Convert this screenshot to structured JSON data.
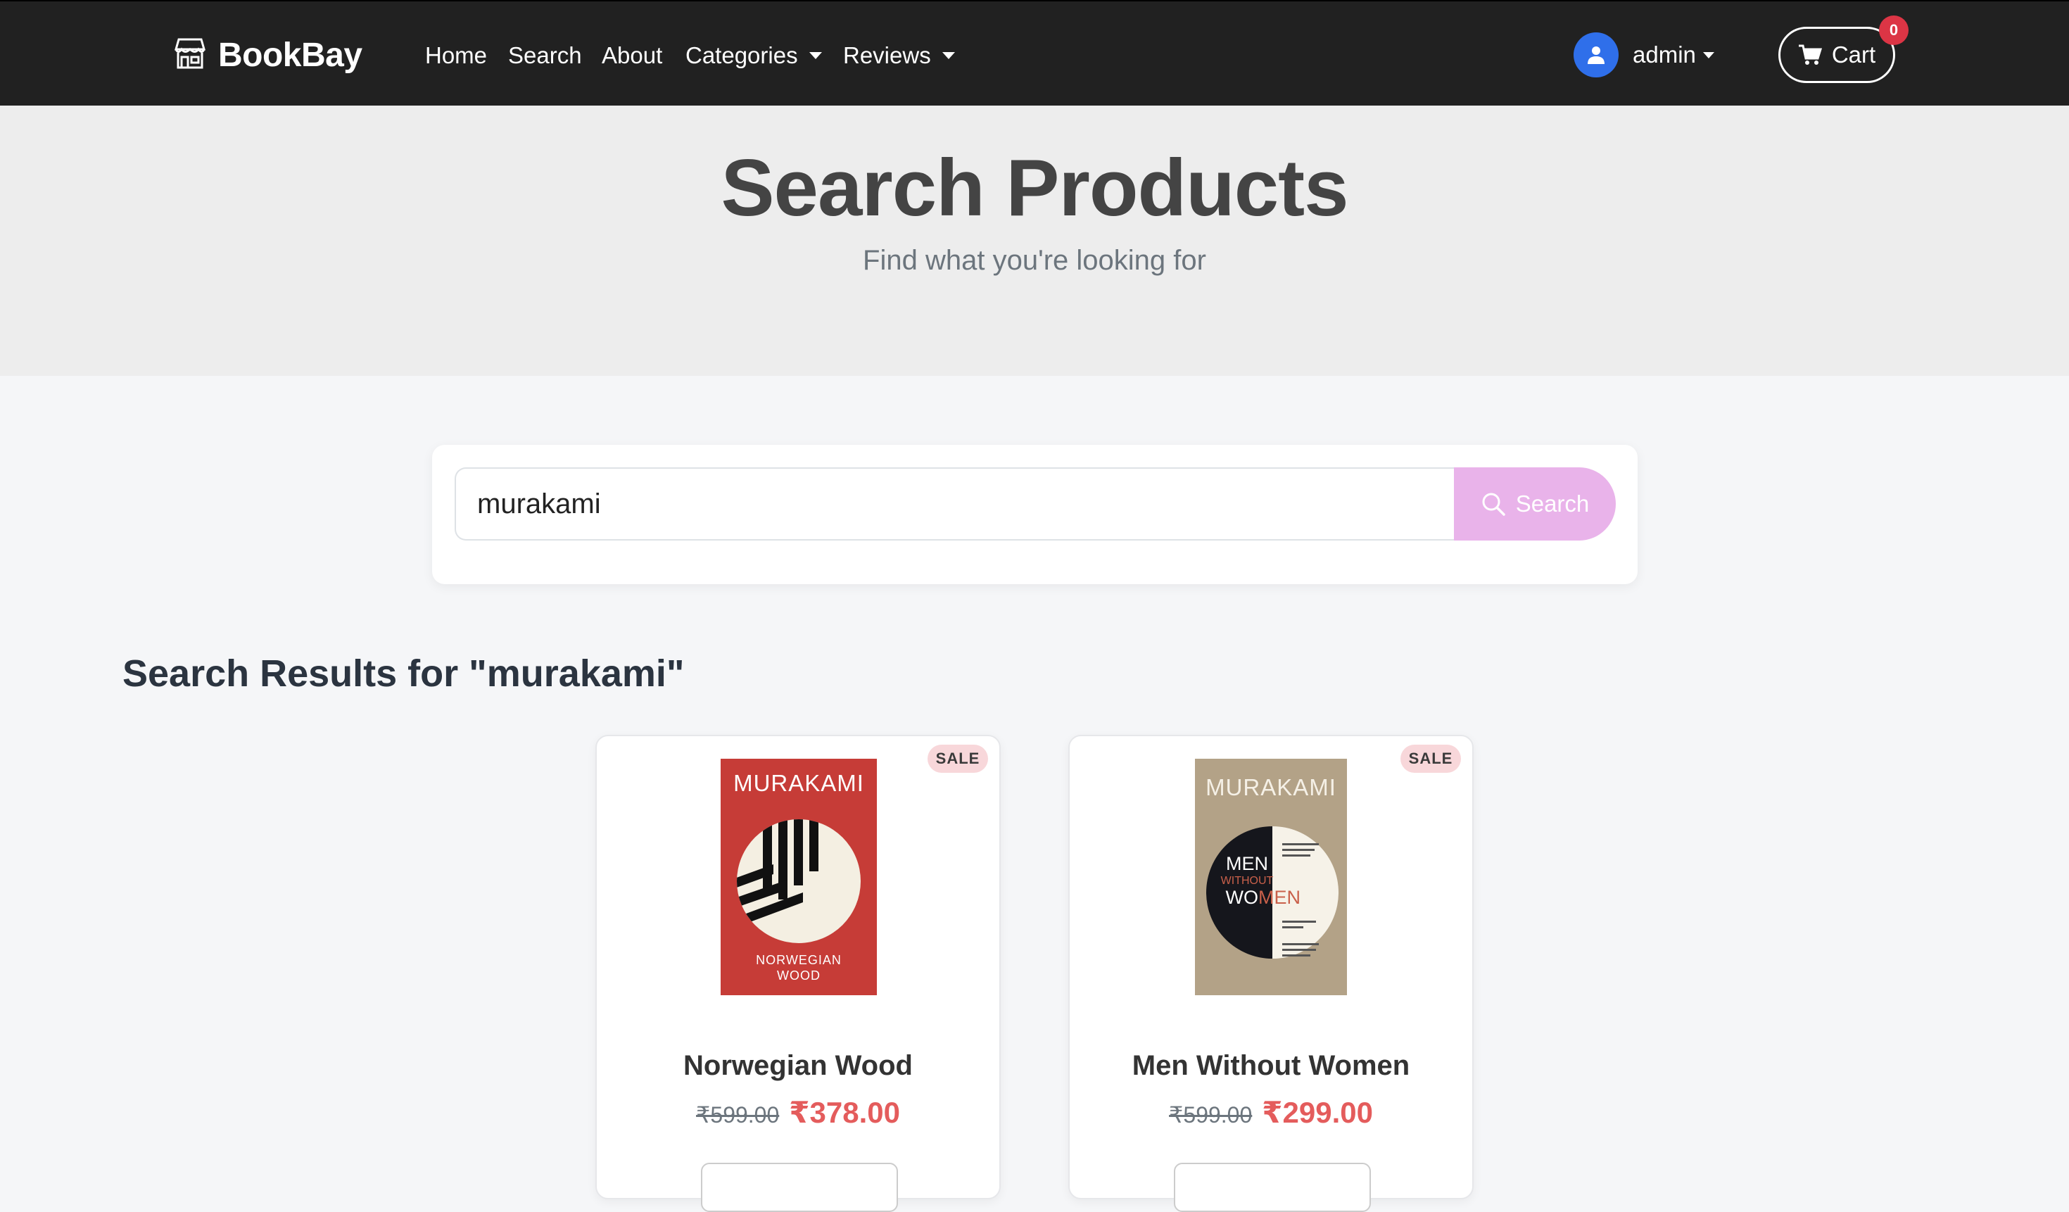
{
  "navbar": {
    "brand": "BookBay",
    "links": [
      "Home",
      "Search",
      "About",
      "Categories",
      "Reviews"
    ],
    "user": "admin",
    "cart_label": "Cart",
    "cart_count": "0"
  },
  "hero": {
    "title": "Search Products",
    "subtitle": "Find what you're looking for"
  },
  "search": {
    "value": "murakami",
    "button_label": "Search"
  },
  "results": {
    "heading": "Search Results for \"murakami\"",
    "products": [
      {
        "title": "Norwegian Wood",
        "badge": "SALE",
        "old_price": "₹599.00",
        "new_price": "₹378.00",
        "cover_author": "MURAKAMI",
        "cover_title_line1": "NORWEGIAN",
        "cover_title_line2": "WOOD",
        "cover_color": "#c63c37"
      },
      {
        "title": "Men Without Women",
        "badge": "SALE",
        "old_price": "₹599.00",
        "new_price": "₹299.00",
        "cover_author": "MURAKAMI",
        "cover_word1": "MEN",
        "cover_word2": "WITHOUT",
        "cover_word3a": "WO",
        "cover_word3b": "MEN",
        "cover_color": "#b3a287"
      }
    ]
  },
  "colors": {
    "navbar": "#212121",
    "search_button": "#e9b3ea",
    "sale_price": "#e45c5c",
    "badge": "#dc3545",
    "avatar": "#2f6fea"
  }
}
